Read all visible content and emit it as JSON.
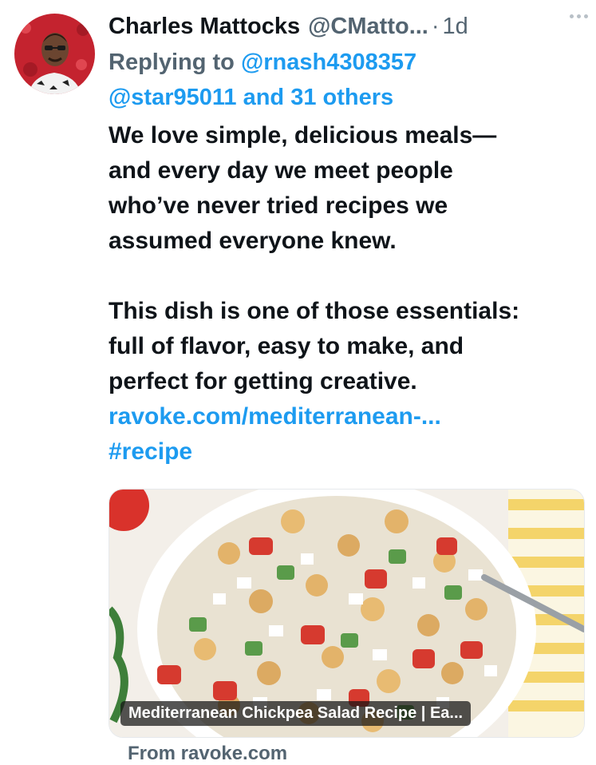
{
  "tweet": {
    "display_name": "Charles Mattocks",
    "handle": "@CMatto...",
    "separator": "·",
    "time": "1d",
    "replying_prefix": "Replying to",
    "reply_to_1": "@rnash4308357",
    "reply_to_2": "@star95011",
    "reply_and": "and",
    "reply_others": "31 others",
    "para1_l1": "We love simple, delicious meals—",
    "para1_l2": "and every day we meet people",
    "para1_l3": "who’ve never tried recipes we",
    "para1_l4": "assumed everyone knew.",
    "para2_l1": "This dish is one of those essentials:",
    "para2_l2": "full of flavor, easy to make, and",
    "para2_l3": "perfect for getting creative.",
    "url": "ravoke.com/mediterranean-...",
    "hashtag": "#recipe"
  },
  "card": {
    "title": "Mediterranean Chickpea Salad Recipe | Ea...",
    "source": "From ravoke.com",
    "image_subject": "chickpea salad in white bowl with fork"
  },
  "icons": {
    "more": "more-horizontal-icon",
    "avatar": "user-avatar"
  },
  "colors": {
    "link": "#1d9bf0",
    "secondary": "#536471",
    "text": "#0f1419"
  }
}
